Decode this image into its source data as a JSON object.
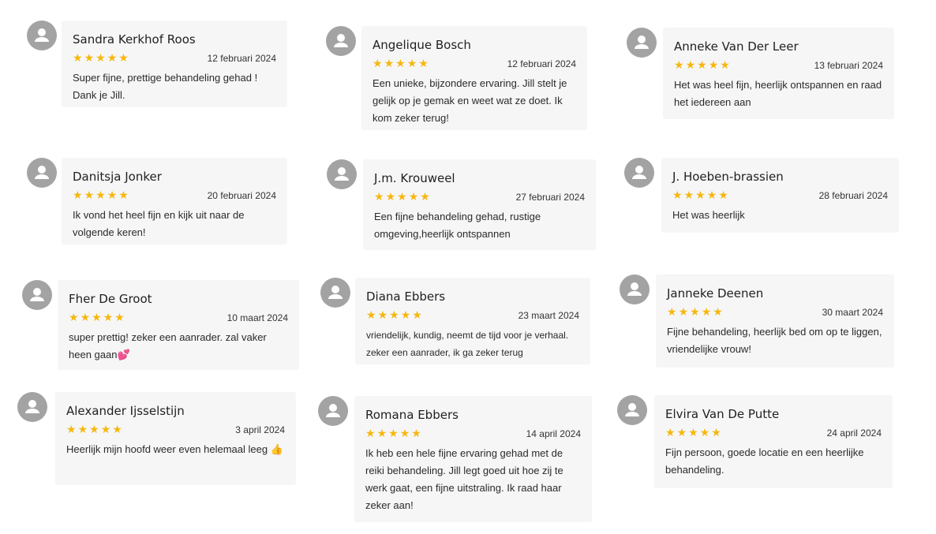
{
  "reviews": [
    {
      "name": "Sandra Kerkhof Roos",
      "date": "12 februari 2024",
      "rating": 5,
      "text": "Super fijne, prettige behandeling gehad ! Dank je Jill."
    },
    {
      "name": "Angelique Bosch",
      "date": "12 februari 2024",
      "rating": 5,
      "text": "Een unieke, bijzondere ervaring. Jill stelt je gelijk op je gemak en weet wat ze doet. Ik kom zeker terug!"
    },
    {
      "name": "Anneke Van Der Leer",
      "date": "13 februari 2024",
      "rating": 5,
      "text": "Het was heel fijn, heerlijk ontspannen en raad het iedereen aan"
    },
    {
      "name": "Danitsja Jonker",
      "date": "20 februari 2024",
      "rating": 5,
      "text": "Ik vond het heel fijn en kijk uit naar de volgende keren!"
    },
    {
      "name": "J.m. Krouweel",
      "date": "27 februari 2024",
      "rating": 5,
      "text": "Een fijne behandeling gehad, rustige omgeving,heerlijk ontspannen"
    },
    {
      "name": "J. Hoeben-brassien",
      "date": "28 februari 2024",
      "rating": 5,
      "text": "Het was heerlijk"
    },
    {
      "name": "Fher De Groot",
      "date": "10 maart 2024",
      "rating": 5,
      "text": "super prettig! zeker een aanrader. zal vaker heen gaan💕"
    },
    {
      "name": "Diana Ebbers",
      "date": "23 maart 2024",
      "rating": 5,
      "text": "vriendelijk, kundig, neemt de tijd voor je verhaal. zeker een aanrader, ik ga zeker terug"
    },
    {
      "name": "Janneke Deenen",
      "date": "30 maart 2024",
      "rating": 5,
      "text": "Fijne behandeling, heerlijk bed om op te liggen, vriendelijke vrouw!"
    },
    {
      "name": "Alexander Ijsselstijn",
      "date": "3 april 2024",
      "rating": 5,
      "text": "Heerlijk mijn hoofd weer even helemaal leeg 👍"
    },
    {
      "name": "Romana Ebbers",
      "date": "14 april 2024",
      "rating": 5,
      "text": "Ik heb een hele fijne ervaring gehad met de reiki behandeling. Jill legt goed uit hoe zij te werk gaat, een fijne uitstraling. Ik raad haar zeker aan!"
    },
    {
      "name": "Elvira Van De Putte",
      "date": "24 april 2024",
      "rating": 5,
      "text": "Fijn persoon, goede locatie en een heerlijke behandeling."
    }
  ]
}
